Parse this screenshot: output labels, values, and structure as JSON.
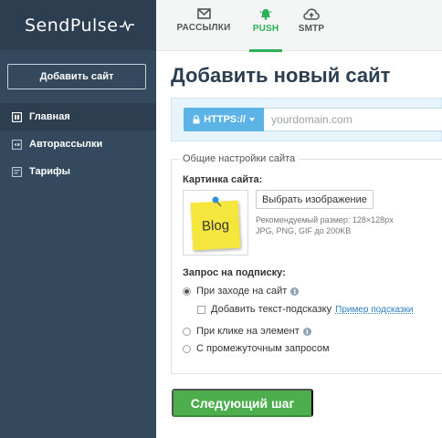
{
  "brand": {
    "logo_text": "SendPulse"
  },
  "sidebar": {
    "add_site_label": "Добавить сайт",
    "items": [
      {
        "label": "Главная",
        "icon": "dashboard-icon",
        "active": true
      },
      {
        "label": "Авторассылки",
        "icon": "autoresponder-icon",
        "active": false
      },
      {
        "label": "Тарифы",
        "icon": "tariffs-icon",
        "active": false
      }
    ]
  },
  "tabs": [
    {
      "label": "РАССЫЛКИ",
      "icon": "envelope-icon",
      "active": false
    },
    {
      "label": "PUSH",
      "icon": "bell-icon",
      "active": true
    },
    {
      "label": "SMTP",
      "icon": "cloud-upload-icon",
      "active": false
    }
  ],
  "main": {
    "title": "Добавить новый сайт",
    "protocol_label": "HTTPS://",
    "domain_placeholder": "yourdomain.com",
    "settings_legend": "Общие настройки сайта",
    "image_label": "Картинка сайта:",
    "thumb_text": "Blog",
    "choose_image_label": "Выбрать изображение",
    "hint_size": "Рекомендуемый размер: 128×128px",
    "hint_formats": "JPG, PNG, GIF до 200KB",
    "subscription_label": "Запрос на подписку:",
    "option_on_visit": "При заходе на сайт",
    "option_add_hint": "Добавить текст-подсказку",
    "hint_example_link": "Пример подсказки",
    "option_on_click": "При клике на элемент",
    "option_intermediate": "С промежуточным запросом",
    "next_label": "Следующий шаг"
  },
  "colors": {
    "sidebar_bg": "#34495e",
    "accent_green": "#2eb05a",
    "primary_button": "#4cae4c",
    "protocol_button": "#5bb4e5"
  }
}
